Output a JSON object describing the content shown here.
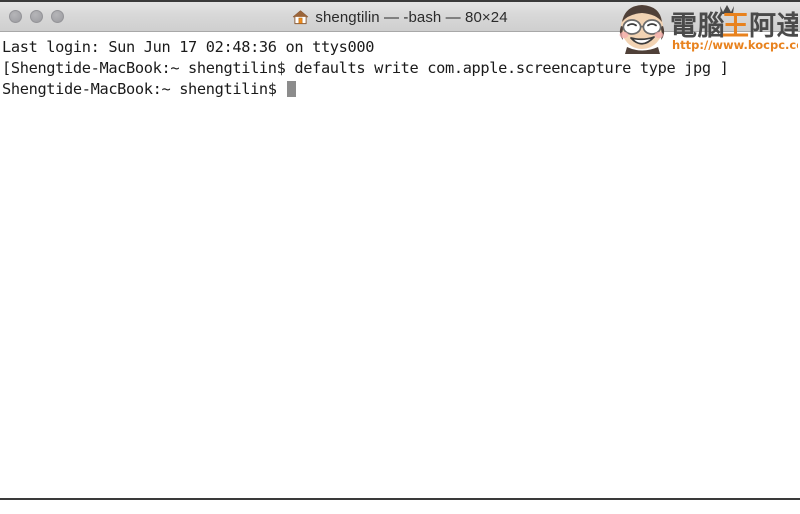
{
  "window": {
    "title": "shengtilin — -bash — 80×24",
    "home_icon": "home-icon",
    "traffic_lights": [
      {
        "name": "close-button",
        "label": ""
      },
      {
        "name": "minimize-button",
        "label": ""
      },
      {
        "name": "zoom-button",
        "label": ""
      }
    ]
  },
  "terminal": {
    "lines": [
      "Last login: Sun Jun 17 02:48:36 on ttys000",
      "[Shengtide-MacBook:~ shengtilin$ defaults write com.apple.screencapture type jpg ]",
      "Shengtide-MacBook:~ shengtilin$ "
    ],
    "cursor": "block-cursor"
  },
  "watermark": {
    "brand": "電腦王阿達",
    "url": "http://www.kocpc.com.tw",
    "brand_color": "#4a4a4a",
    "accent_color": "#e8821e",
    "mascot": "mascot-face-icon"
  }
}
